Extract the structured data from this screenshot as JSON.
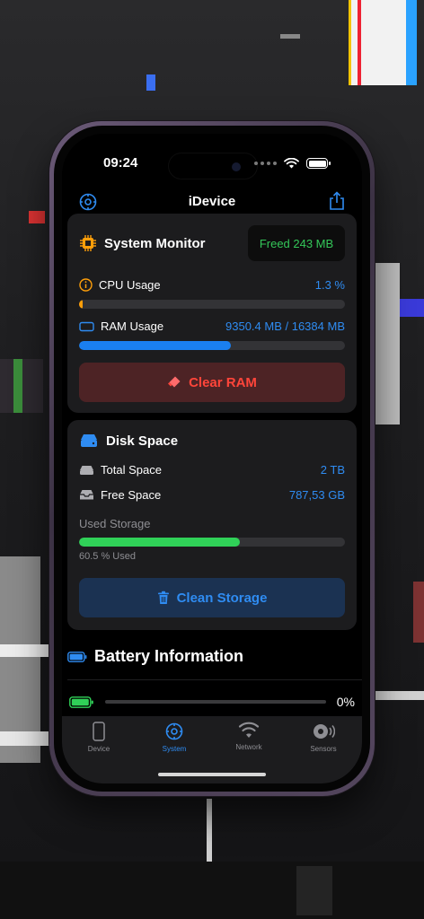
{
  "status_bar": {
    "time": "09:24"
  },
  "nav": {
    "title": "iDevice",
    "left_icon": "gear-icon",
    "right_icon": "share-icon"
  },
  "system_monitor": {
    "title": "System Monitor",
    "freed_label": "Freed 243 MB",
    "cpu": {
      "label": "CPU Usage",
      "value": "1.3 %",
      "percent": 1.3
    },
    "ram": {
      "label": "RAM Usage",
      "value": "9350.4 MB / 16384 MB",
      "percent": 57.1
    },
    "clear_button": "Clear RAM"
  },
  "disk_space": {
    "title": "Disk Space",
    "total": {
      "label": "Total Space",
      "value": "2 TB"
    },
    "free": {
      "label": "Free Space",
      "value": "787,53 GB"
    },
    "used_label": "Used Storage",
    "used_percent": 60.5,
    "used_text": "60.5 % Used",
    "clean_button": "Clean Storage"
  },
  "battery": {
    "title": "Battery Information",
    "level_text": "0%",
    "level": 0
  },
  "tabs": [
    {
      "label": "Device",
      "icon": "phone-icon",
      "active": false
    },
    {
      "label": "System",
      "icon": "gear-icon",
      "active": true
    },
    {
      "label": "Network",
      "icon": "wifi-icon",
      "active": false
    },
    {
      "label": "Sensors",
      "icon": "sensor-icon",
      "active": false
    }
  ],
  "colors": {
    "accent": "#2f8cf2",
    "danger": "#ff453a",
    "success": "#34c759",
    "warning": "#ff9f0a"
  }
}
